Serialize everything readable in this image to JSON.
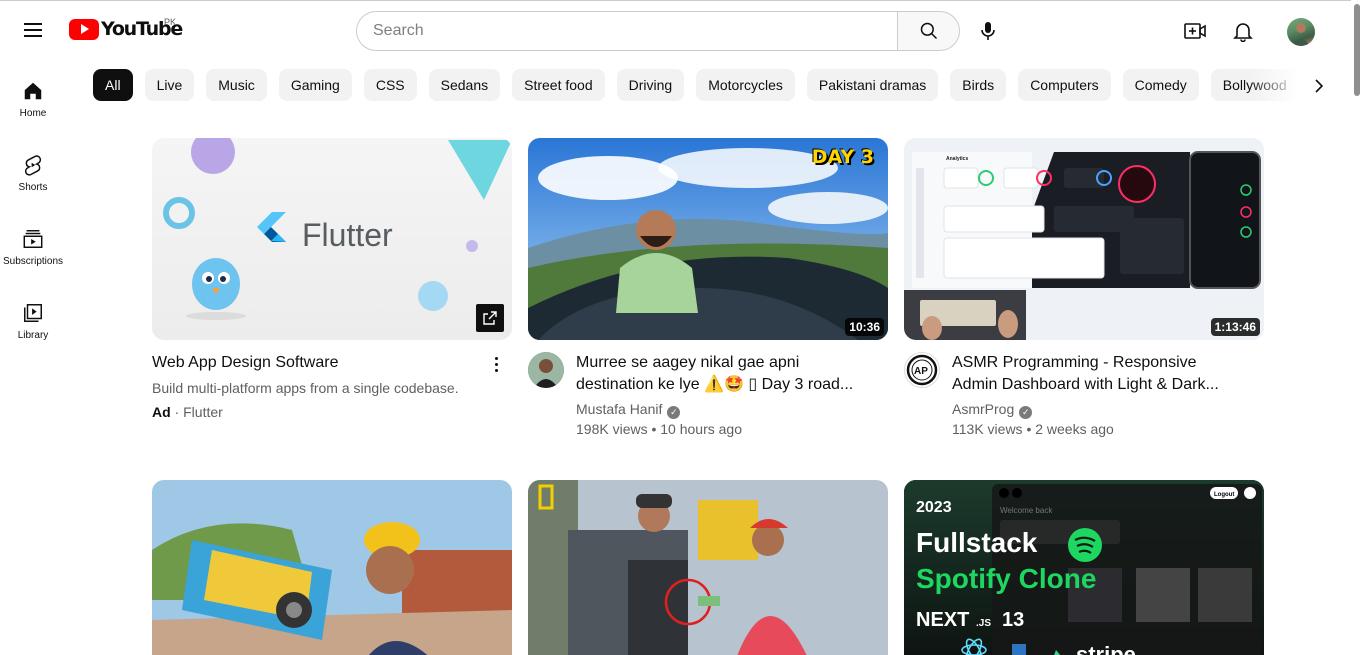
{
  "header": {
    "logo_text": "YouTube",
    "country_code": "PK",
    "search_placeholder": "Search"
  },
  "sidebar": {
    "items": [
      {
        "label": "Home",
        "icon": "home-icon"
      },
      {
        "label": "Shorts",
        "icon": "shorts-icon"
      },
      {
        "label": "Subscriptions",
        "icon": "subscriptions-icon"
      },
      {
        "label": "Library",
        "icon": "library-icon"
      }
    ]
  },
  "chips": [
    "All",
    "Live",
    "Music",
    "Gaming",
    "CSS",
    "Sedans",
    "Street food",
    "Driving",
    "Motorcycles",
    "Pakistani dramas",
    "Birds",
    "Computers",
    "Comedy",
    "Bollywood"
  ],
  "ad": {
    "thumb_text": "Flutter",
    "title": "Web App Design Software",
    "description": "Build multi-platform apps from a single codebase.",
    "ad_label": "Ad",
    "separator": " · ",
    "advertiser": "Flutter"
  },
  "videos": [
    {
      "title": "Murree se aagey nikal gae apni destination ke lye ⚠️🤩 ▯ Day 3 road...",
      "channel": "Mustafa Hanif",
      "views": "198K views • 10 hours ago",
      "duration": "10:36",
      "badge": "DAY 3"
    },
    {
      "title": "ASMR Programming - Responsive Admin Dashboard with Light & Dark...",
      "channel": "AsmrProg",
      "views": "113K views • 2 weeks ago",
      "duration": "1:13:46",
      "dashboard_heading": "Analytics"
    }
  ],
  "row2": {
    "spotify": {
      "year": "2023",
      "line1": "Fullstack",
      "line2": "Spotify Clone",
      "next": "NEXT",
      "js": ".JS",
      "version": "13",
      "stripe": "stripe",
      "logout": "Logout",
      "welcome": "Welcome back"
    }
  },
  "colors": {
    "brand_red": "#ff0000",
    "chip_bg": "#f2f2f2",
    "chip_active_bg": "#0f0f0f",
    "spotify_green": "#1ed760"
  }
}
